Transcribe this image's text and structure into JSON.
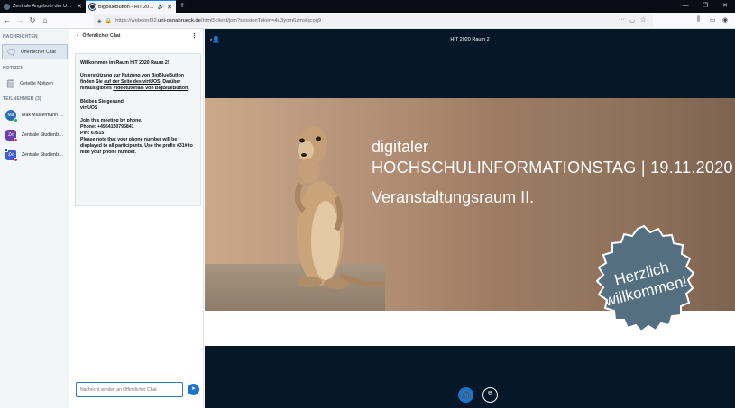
{
  "browser": {
    "tabs": [
      {
        "label": "Zentrale Angebote der Univers",
        "active": false
      },
      {
        "label": "BigBlueButton - HIT 2020 R",
        "active": true
      }
    ],
    "new_tab": "+",
    "url": {
      "prefix": "https://webconf32.",
      "domain": "uni-osnabrueck.de",
      "suffix": "/html5client/join?sessionToken=4u3yom6zmsiqcoq9"
    }
  },
  "sidebar": {
    "messages_title": "NACHRICHTEN",
    "public_chat": "Öffentlicher Chat",
    "notes_title": "NOTIZEN",
    "shared_notes": "Geteilte Notizen",
    "participants_title": "TEILNEHMER (3)",
    "participants": [
      {
        "initials": "Ma",
        "name": "Max Mustermann (Sie)"
      },
      {
        "initials": "Ze",
        "name": "Zentrale Studienber…"
      },
      {
        "initials": "Ze",
        "name": "Zentrale Studienber…"
      }
    ]
  },
  "chat": {
    "title": "Öffentlicher Chat",
    "welcome": "Willkommen im Raum HIT 2020 Raum 2!",
    "support_1": "Unterstützung zur Nutzung von BigBlueButton finden Sie ",
    "support_link": "auf der Seite des virtUOS",
    "support_2": ". Darüber hinaus gibt es ",
    "video_link": "Videotutorials von BigBlueButton",
    "support_3": ".",
    "greeting_1": "Bleiben Sie gesund,",
    "greeting_2": "virtUOS",
    "phone_intro": "Join this meeting by phone.",
    "phone_number": "Phone: +4954150795841",
    "pin": "PIN: 67515",
    "phone_note": "Please note that your phone number will be displayed to all participants. Use the prefix #31# to hide your phone number.",
    "input_placeholder": "Nachricht senden an Öffentlicher Chat"
  },
  "presentation": {
    "meeting_title": "HIT 2020 Raum 2",
    "line1": "digitaler",
    "line2": "HOCHSCHULINFORMATIONSTAG | 19.11.2020",
    "line3": "Veranstaltungsraum II.",
    "badge_line1": "Herzlich",
    "badge_line2": "willkommen!"
  },
  "colors": {
    "accent": "#1b74c6",
    "main_bg": "#06172a",
    "badge": "#546f80"
  }
}
